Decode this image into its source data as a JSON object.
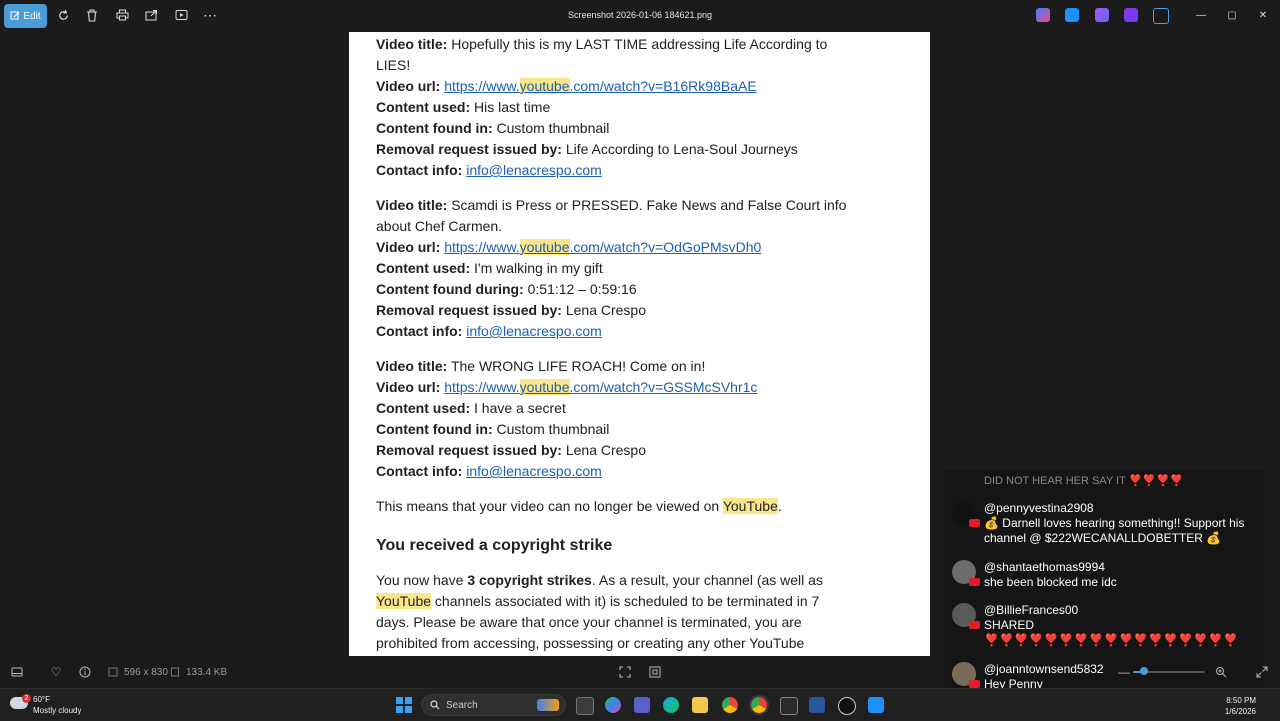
{
  "window": {
    "title": "Screenshot 2026-01-06 184621.png",
    "edit_label": "Edit"
  },
  "colors": {
    "accent": "#4a9cd6",
    "link": "#1a5fb4",
    "highlight": "#fde68a",
    "live_badge": "#e11d2a"
  },
  "document": {
    "entries": [
      {
        "title_label": "Video title:",
        "title": "Hopefully this is my LAST TIME addressing Life According to LIES!",
        "url_label": "Video url:",
        "url_pre": "https://www.",
        "url_hl": "youtube",
        "url_post": ".com/watch?v=B16Rk98BaAE",
        "content_label": "Content used:",
        "content": "His last time",
        "found_label": "Content found in:",
        "found": "Custom thumbnail",
        "removal_label": "Removal request issued by:",
        "removal": "Life According to Lena-Soul Journeys",
        "contact_label": "Contact info:",
        "contact": "info@lenacrespo.com"
      },
      {
        "title_label": "Video title:",
        "title": "Scamdi is Press or PRESSED. Fake News and False Court info about Chef Carmen.",
        "url_label": "Video url:",
        "url_pre": "https://www.",
        "url_hl": "youtube",
        "url_post": ".com/watch?v=OdGoPMsvDh0",
        "content_label": "Content used:",
        "content": "I'm walking in my gift",
        "found_label": "Content found during:",
        "found": "0:51:12 – 0:59:16",
        "removal_label": "Removal request issued by:",
        "removal": "Lena Crespo",
        "contact_label": "Contact info:",
        "contact": "info@lenacrespo.com"
      },
      {
        "title_label": "Video title:",
        "title": "The WRONG LIFE ROACH! Come on in!",
        "url_label": "Video url:",
        "url_pre": "https://www.",
        "url_hl": "youtube",
        "url_post": ".com/watch?v=GSSMcSVhr1c",
        "content_label": "Content used:",
        "content": "I have a secret",
        "found_label": "Content found in:",
        "found": "Custom thumbnail",
        "removal_label": "Removal request issued by:",
        "removal": "Lena Crespo",
        "contact_label": "Contact info:",
        "contact": "info@lenacrespo.com"
      }
    ],
    "notice_pre": "This means that your video can no longer be viewed on ",
    "notice_hl": "YouTube",
    "notice_post": ".",
    "heading": "You received a copyright strike",
    "strike_pre": "You now have ",
    "strike_bold": "3 copyright strikes",
    "strike_mid": ". As a result, your channel (as well as ",
    "strike_hl": "YouTube",
    "strike_post": " channels associated with it) is scheduled to be terminated in 7 days. Please be aware that once your channel is terminated, you are",
    "strike_cut": "prohibited from accessing, possessing or creating any other YouTube"
  },
  "infobar": {
    "dimensions": "596 x 830",
    "filesize": "133.4 KB"
  },
  "chat": {
    "faded_text": "DID NOT HEAR HER SAY IT ❣️❣️❣️❣️",
    "messages": [
      {
        "user": "@pennyvestina2908",
        "text": "💰 Darnell loves hearing something!! Support his channel @ $222WECANALLDOBETTER 💰"
      },
      {
        "user": "@shantaethomas9994",
        "text": "she been blocked me idc"
      },
      {
        "user": "@BillieFrances00",
        "text": "SHARED ❣️❣️❣️❣️❣️❣️❣️❣️❣️❣️❣️❣️❣️❣️❣️❣️❣️"
      },
      {
        "user": "@joanntownsend5832",
        "text": "Hey Penny"
      }
    ]
  },
  "zoom": {
    "level": 0.15
  },
  "taskbar": {
    "weather_temp": "60°F",
    "weather_desc": "Mostly cloudy",
    "weather_badge": "2",
    "search_placeholder": "Search",
    "time": "8:50 PM",
    "date": "1/6/2026"
  }
}
